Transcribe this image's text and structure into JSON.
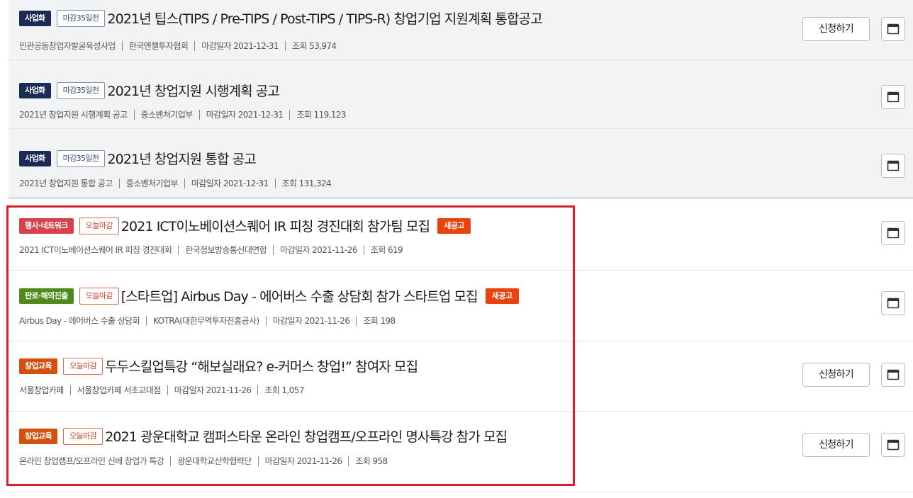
{
  "rows": [
    {
      "category": "사업화",
      "category_color": "#1a2b55",
      "dday": "마감35일전",
      "title": "2021년 팁스(TIPS / Pre-TIPS / Post-TIPS / TIPS-R) 창업기업 지원계획 통합공고",
      "new_badge": "",
      "meta": [
        "민관공동창업자발굴육성사업",
        "한국엔젤투자협회",
        "마감일자 2021-12-31",
        "조회 53,974"
      ],
      "apply_label": "신청하기"
    },
    {
      "category": "사업화",
      "category_color": "#1a2b55",
      "dday": "마감35일전",
      "title": "2021년 창업지원 시행계획 공고",
      "new_badge": "",
      "meta": [
        "2021년 창업지원 시행계획 공고",
        "중소벤처기업부",
        "마감일자 2021-12-31",
        "조회 119,123"
      ],
      "apply_label": ""
    },
    {
      "category": "사업화",
      "category_color": "#1a2b55",
      "dday": "마감35일전",
      "title": "2021년 창업지원 통합 공고",
      "new_badge": "",
      "meta": [
        "2021년 창업지원 통합 공고",
        "중소벤처기업부",
        "마감일자 2021-12-31",
        "조회 131,324"
      ],
      "apply_label": ""
    },
    {
      "category": "행사·네트워크",
      "category_color": "#d9414a",
      "dday": "오늘마감",
      "title": "2021 ICT이노베이션스퀘어 IR 피칭 경진대회 참가팀 모집",
      "new_badge": "새공고",
      "meta": [
        "2021 ICT이노베이션스퀘어 IR 피칭 경진대회",
        "한국정보방송통신대연합",
        "마감일자 2021-11-26",
        "조회 619"
      ],
      "apply_label": ""
    },
    {
      "category": "판로·해외진출",
      "category_color": "#4d8a1a",
      "dday": "오늘마감",
      "title": "[스타트업] Airbus Day - 에어버스 수출 상담회 참가 스타트업 모집",
      "new_badge": "새공고",
      "meta": [
        "Airbus Day - 에어버스 수출 상담회",
        "KOTRA(대한무역투자진흥공사)",
        "마감일자 2021-11-26",
        "조회 198"
      ],
      "apply_label": ""
    },
    {
      "category": "창업교육",
      "category_color": "#d4500f",
      "dday": "오늘마감",
      "title": "두두스킬업특강 “해보실래요? e-커머스 창업!” 참여자 모집",
      "new_badge": "",
      "meta": [
        "서울창업카페",
        "서울창업카페 서초교대점",
        "마감일자 2021-11-26",
        "조회 1,057"
      ],
      "apply_label": "신청하기"
    },
    {
      "category": "창업교육",
      "category_color": "#d4500f",
      "dday": "오늘마감",
      "title": "2021 광운대학교 캠퍼스타운 온라인 창업캠프/오프라인 명사특강 참가 모집",
      "new_badge": "",
      "meta": [
        "온라인 창업캠프/오프라인 신베 창업가 특강",
        "광운대학교산학협력단",
        "마감일자 2021-11-26",
        "조회 958"
      ],
      "apply_label": "신청하기"
    }
  ],
  "icons": {
    "save": "bookmark-window-icon"
  },
  "highlight_color": "#d9202a"
}
